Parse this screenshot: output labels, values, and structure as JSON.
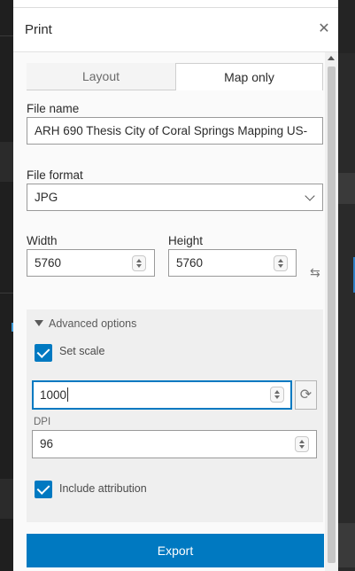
{
  "panel": {
    "title": "Print",
    "close_icon": "✕"
  },
  "tabs": [
    {
      "label": "Layout",
      "active": false
    },
    {
      "label": "Map only",
      "active": true
    }
  ],
  "file_name": {
    "label": "File name",
    "value": "ARH 690 Thesis City of Coral Springs Mapping US-"
  },
  "file_format": {
    "label": "File format",
    "value": "JPG"
  },
  "width": {
    "label": "Width",
    "value": "5760"
  },
  "height": {
    "label": "Height",
    "value": "5760"
  },
  "swap_icon": "⇆",
  "advanced": {
    "toggle_label": "Advanced options",
    "set_scale_label": "Set scale",
    "set_scale_checked": true,
    "scale_value": "1000",
    "refresh_icon": "⟳",
    "dpi_label": "DPI",
    "dpi_value": "96",
    "include_attribution_label": "Include attribution",
    "include_attribution_checked": true
  },
  "export_label": "Export",
  "colors": {
    "accent": "#0079c1",
    "background_app": "#1f1f1f"
  }
}
